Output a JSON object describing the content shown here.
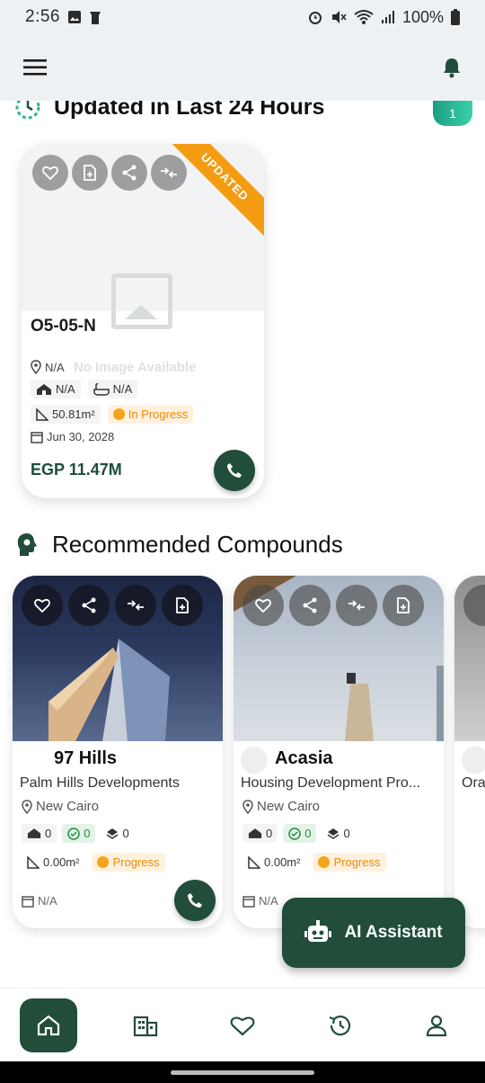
{
  "status_bar": {
    "time": "2:56",
    "battery": "100%"
  },
  "sections": {
    "updated_title": "Updated in Last 24 Hours",
    "updated_count": "1",
    "recommended_title": "Recommended Compounds"
  },
  "updated_card": {
    "ribbon": "UPDATED",
    "unit_code": "O5-05-N",
    "location": "N/A",
    "no_image": "No Image Available",
    "bedrooms": "N/A",
    "bathrooms": "N/A",
    "area": "50.81m²",
    "status": "In Progress",
    "delivery_date": "Jun 30, 2028",
    "price": "EGP 11.47M"
  },
  "compounds": [
    {
      "name": "97 Hills",
      "developer": "Palm Hills Developments",
      "location": "New Cairo",
      "units": "0",
      "available": "0",
      "phases": "0",
      "area": "0.00m²",
      "status": "Progress",
      "delivery": "N/A"
    },
    {
      "name": "Acasia",
      "developer": "Housing Development Pro...",
      "location": "New Cairo",
      "units": "0",
      "available": "0",
      "phases": "0",
      "area": "0.00m²",
      "status": "Progress",
      "delivery": "N/A"
    },
    {
      "developer_partial": "Ora"
    }
  ],
  "fab": {
    "label": "AI Assistant"
  },
  "colors": {
    "primary": "#214d3a",
    "ribbon": "#f39c12",
    "accent_teal": "#2bb596"
  }
}
